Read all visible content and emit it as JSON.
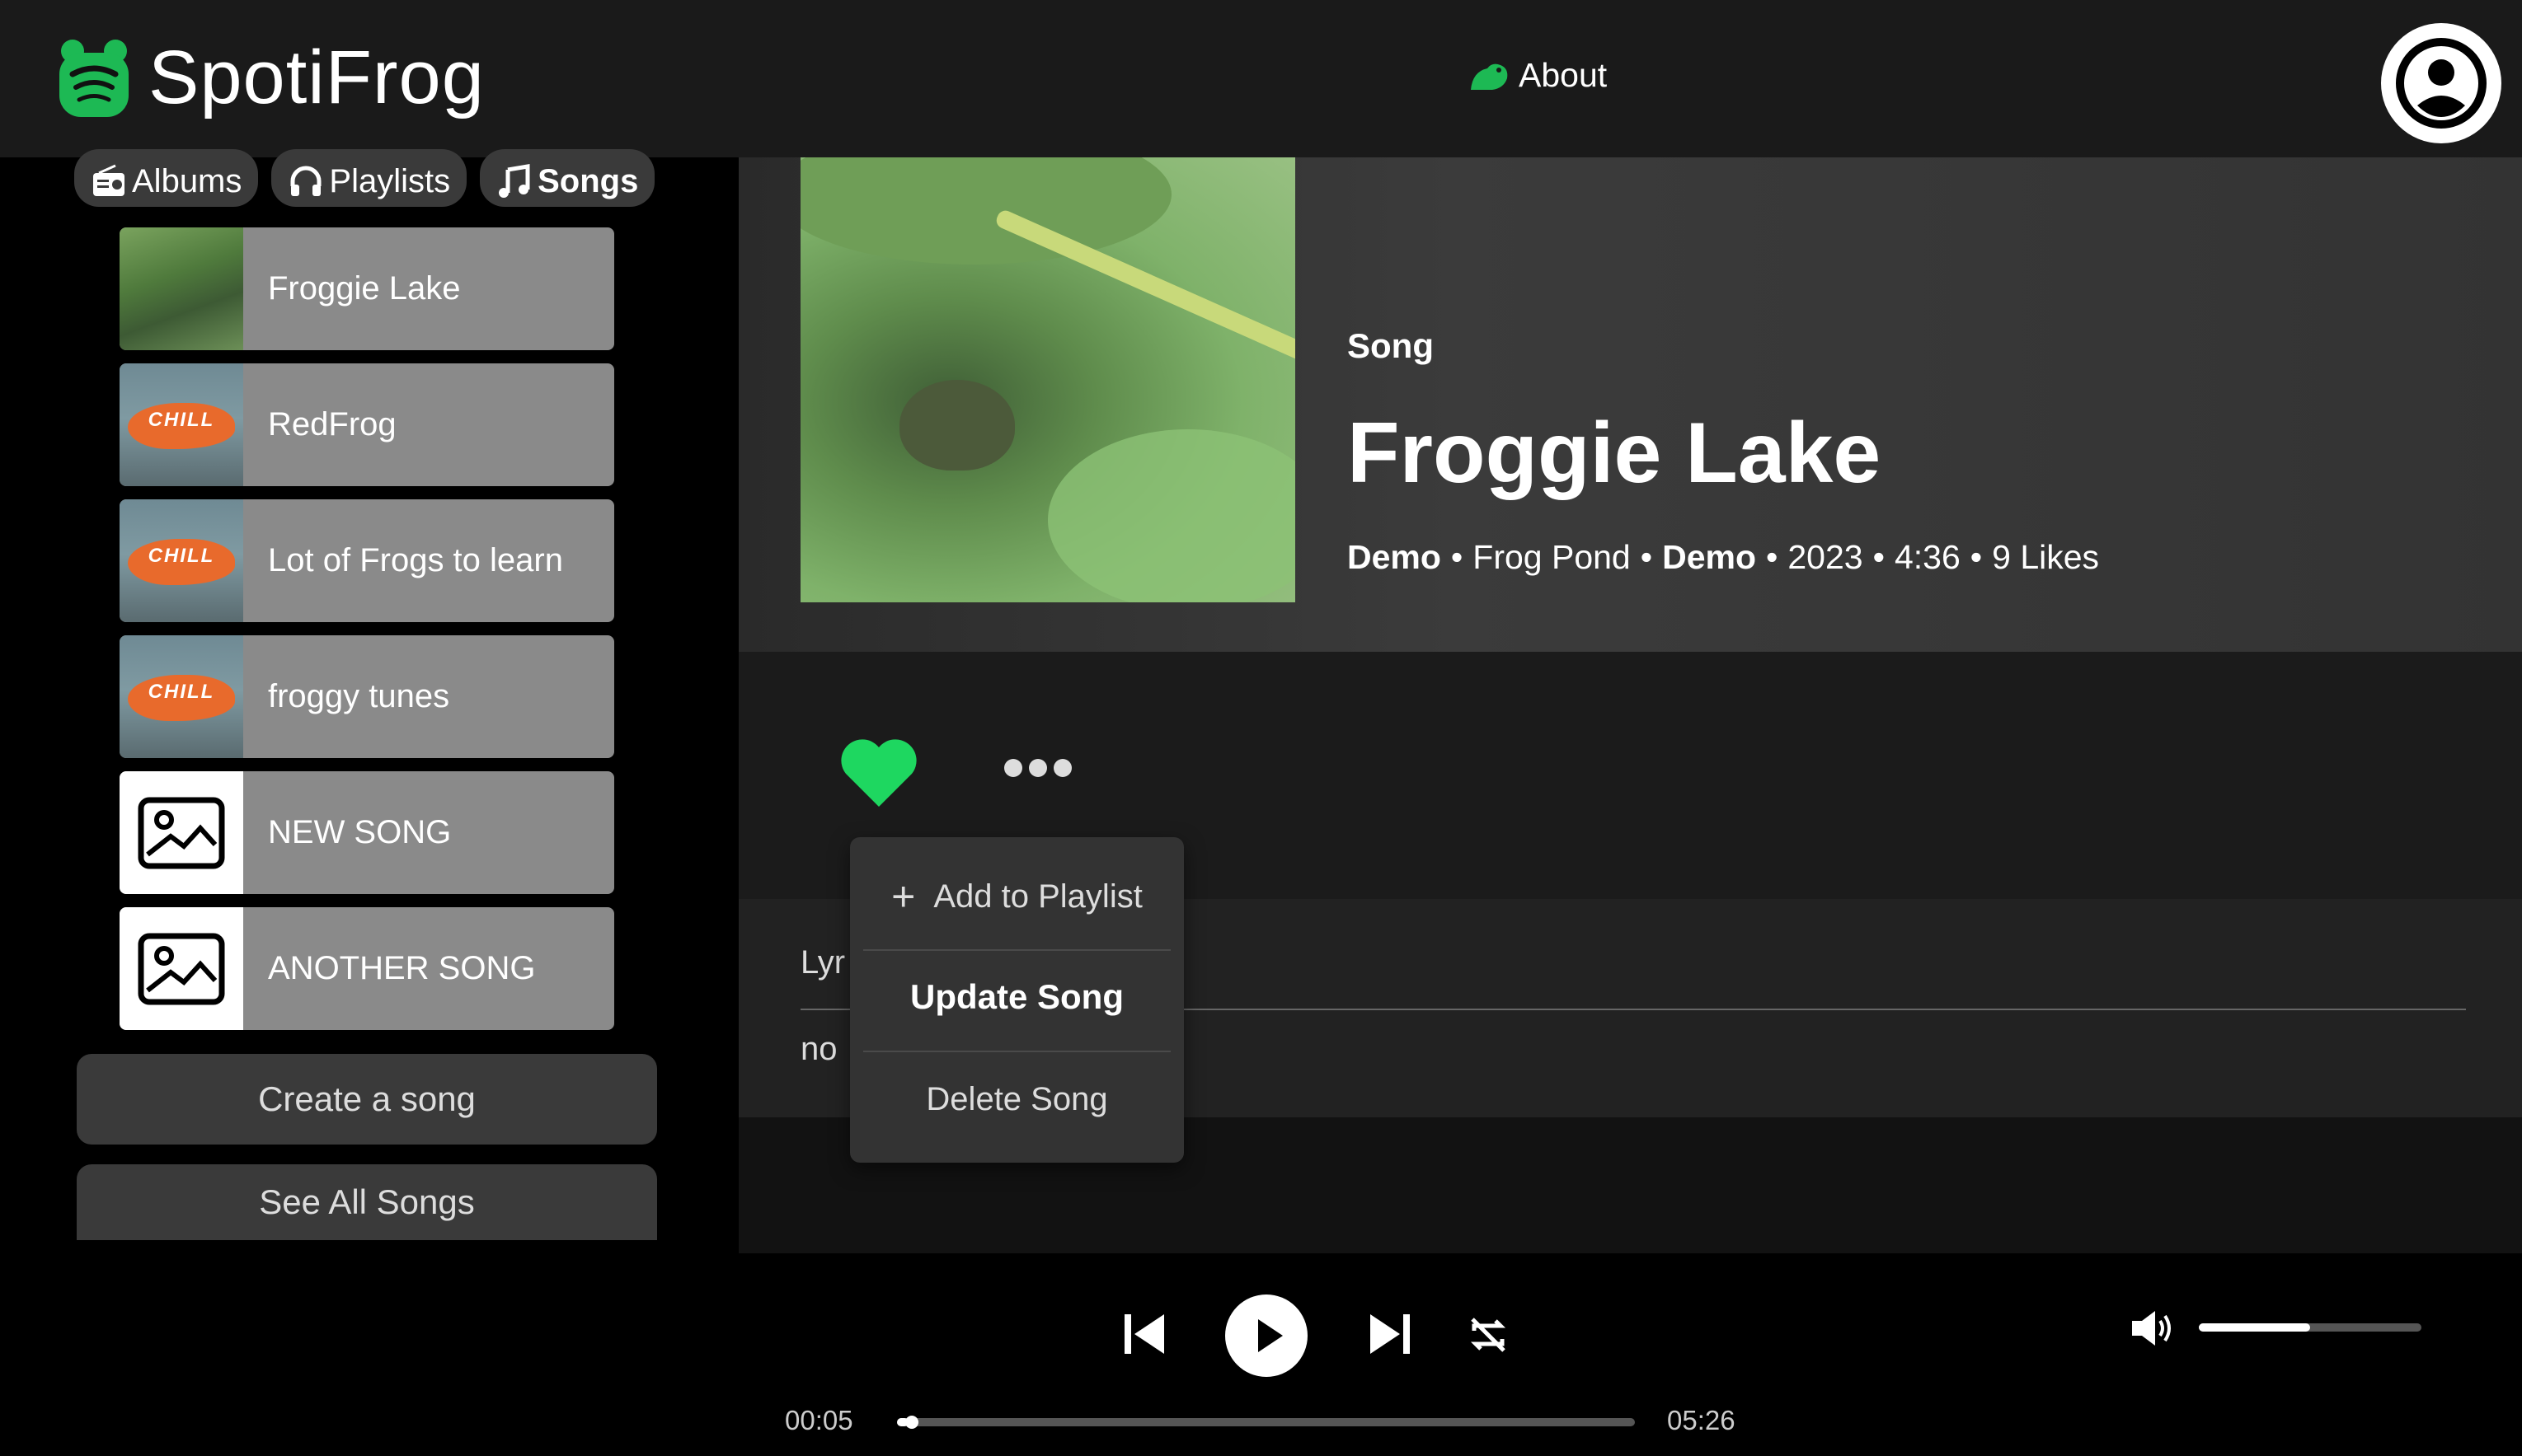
{
  "app": {
    "name": "SpotiFrog",
    "accent": "#1db954",
    "heart_color": "#1ed760"
  },
  "header": {
    "about_label": "About"
  },
  "sidebar": {
    "tabs": [
      {
        "label": "Albums",
        "icon": "radio-icon"
      },
      {
        "label": "Playlists",
        "icon": "headphones-icon"
      },
      {
        "label": "Songs",
        "icon": "music-note-icon",
        "active": true
      }
    ],
    "songs": [
      {
        "title": "Froggie Lake",
        "art": "frog-photo"
      },
      {
        "title": "RedFrog",
        "art": "chill-cover"
      },
      {
        "title": "Lot of Frogs to learn",
        "art": "chill-cover"
      },
      {
        "title": "froggy tunes",
        "art": "chill-cover"
      },
      {
        "title": "NEW SONG",
        "art": "image-placeholder"
      },
      {
        "title": "ANOTHER SONG",
        "art": "image-placeholder"
      }
    ],
    "chill_text": "CHILL",
    "create_button": "Create a song",
    "see_all_button": "See All Songs"
  },
  "song": {
    "kind": "Song",
    "title": "Froggie Lake",
    "artist": "Demo",
    "album": "Frog Pond",
    "owner": "Demo",
    "year": "2023",
    "duration": "4:36",
    "likes": "9 Likes",
    "separator": "•",
    "liked": true
  },
  "menu": {
    "add_to_playlist": "Add to Playlist",
    "plus": "+",
    "update": "Update Song",
    "delete": "Delete Song"
  },
  "lyrics": {
    "label": "Lyr",
    "text": "no"
  },
  "player": {
    "current_time": "00:05",
    "total_time": "05:26",
    "progress": 0.016,
    "volume": 0.5
  }
}
